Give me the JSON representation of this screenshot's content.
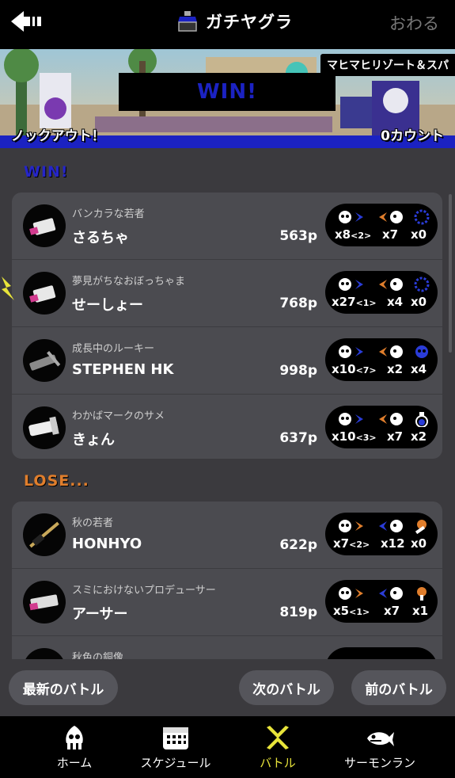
{
  "header": {
    "title": "ガチヤグラ",
    "exit_label": "おわる"
  },
  "banner": {
    "stage": "マヒマヒリゾート＆スパ",
    "result": "WIN!",
    "rule": "ノックアウト！",
    "countdown": "0カウント"
  },
  "sections": {
    "win_label": "WIN!",
    "lose_label": "LOSE..."
  },
  "win_team": [
    {
      "title": "バンカラな若者",
      "name": "さるちゃ",
      "points": "563p",
      "kills": "x8",
      "assists": "<2>",
      "specials": "x7",
      "sub_count": "x0",
      "self": false
    },
    {
      "title": "夢見がちなおぼっちゃま",
      "name": "せーしょー",
      "points": "768p",
      "kills": "x27",
      "assists": "<1>",
      "specials": "x4",
      "sub_count": "x0",
      "self": true
    },
    {
      "title": "成長中のルーキー",
      "name": "STEPHEN HK",
      "points": "998p",
      "kills": "x10",
      "assists": "<7>",
      "specials": "x2",
      "sub_count": "x4",
      "self": false
    },
    {
      "title": "わかばマークのサメ",
      "name": "きょん",
      "points": "637p",
      "kills": "x10",
      "assists": "<3>",
      "specials": "x7",
      "sub_count": "x2",
      "self": false
    }
  ],
  "lose_team": [
    {
      "title": "秋の若者",
      "name": "HONHYO",
      "points": "622p",
      "kills": "x7",
      "assists": "<2>",
      "specials": "x12",
      "sub_count": "x0"
    },
    {
      "title": "スミにおけないプロデューサー",
      "name": "アーサー",
      "points": "819p",
      "kills": "x5",
      "assists": "<1>",
      "specials": "x7",
      "sub_count": "x1"
    },
    {
      "title": "秋色の銅像",
      "name": "",
      "points": "",
      "kills": "",
      "assists": "",
      "specials": "",
      "sub_count": ""
    }
  ],
  "buttons": {
    "latest": "最新のバトル",
    "next": "次のバトル",
    "prev": "前のバトル"
  },
  "tabs": [
    {
      "label": "ホーム",
      "icon": "squid-icon"
    },
    {
      "label": "スケジュール",
      "icon": "calendar-icon"
    },
    {
      "label": "バトル",
      "icon": "battle-icon",
      "active": true
    },
    {
      "label": "サーモンラン",
      "icon": "salmon-icon"
    }
  ],
  "colors": {
    "win": "#1b22c2",
    "lose": "#e07e2c",
    "active_tab": "#e8e43a",
    "background": "#3b3a3e",
    "card": "#4b4b50"
  }
}
